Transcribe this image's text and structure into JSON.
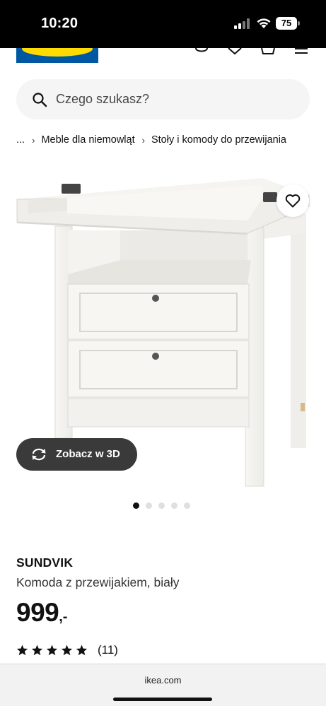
{
  "status_bar": {
    "time": "10:20",
    "battery": "75"
  },
  "search": {
    "placeholder": "Czego szukasz?"
  },
  "breadcrumb": {
    "items": [
      "...",
      "Meble dla niemowląt",
      "Stoły i komody do przewijania"
    ]
  },
  "gallery": {
    "view3d_label": "Zobacz w 3D",
    "image_count": 5,
    "active_index": 0
  },
  "product": {
    "brand": "SUNDVIK",
    "description": "Komoda z przewijakiem, biały",
    "price_integer": "999",
    "price_suffix": ",-",
    "rating_stars": 5,
    "review_count": "(11)"
  },
  "browser": {
    "url": "ikea.com"
  },
  "colors": {
    "brand_blue": "#0058a3",
    "brand_yellow": "#ffdb00",
    "button_dark": "#3a3a3a"
  }
}
